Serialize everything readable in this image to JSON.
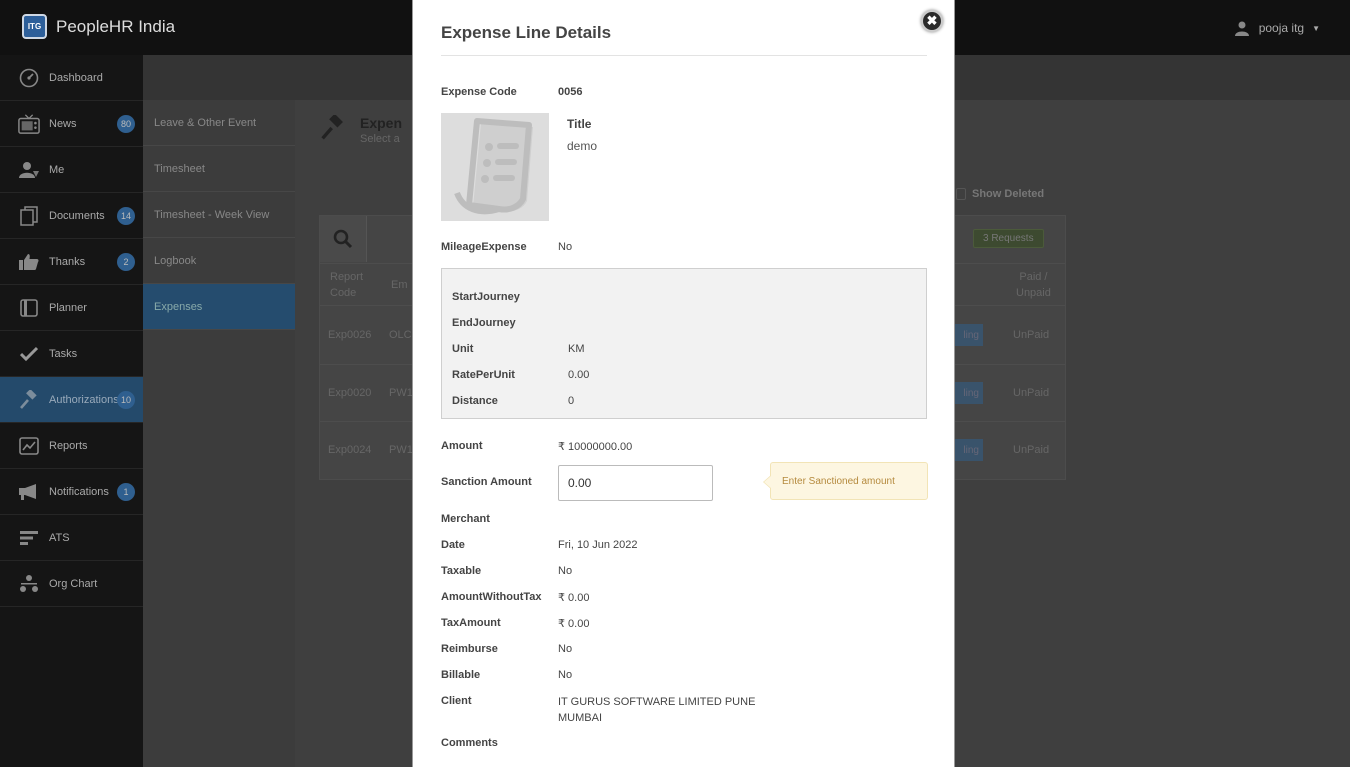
{
  "app": {
    "title": "PeopleHR India",
    "logo_text": "ITG",
    "user_name": "pooja itg"
  },
  "sidebar": {
    "items": [
      {
        "label": "Dashboard",
        "icon": "dashboard-icon",
        "badge": ""
      },
      {
        "label": "News",
        "icon": "tv-icon",
        "badge": "80"
      },
      {
        "label": "Me",
        "icon": "user-icon",
        "badge": ""
      },
      {
        "label": "Documents",
        "icon": "documents-icon",
        "badge": "14"
      },
      {
        "label": "Thanks",
        "icon": "thumbs-up-icon",
        "badge": "2"
      },
      {
        "label": "Planner",
        "icon": "planner-icon",
        "badge": ""
      },
      {
        "label": "Tasks",
        "icon": "check-icon",
        "badge": ""
      },
      {
        "label": "Authorizations",
        "icon": "gavel-icon",
        "badge": "10"
      },
      {
        "label": "Reports",
        "icon": "reports-icon",
        "badge": ""
      },
      {
        "label": "Notifications",
        "icon": "megaphone-icon",
        "badge": "1"
      },
      {
        "label": "ATS",
        "icon": "ats-icon",
        "badge": ""
      },
      {
        "label": "Org Chart",
        "icon": "org-chart-icon",
        "badge": ""
      }
    ],
    "active_index": 7
  },
  "subnav": {
    "items": [
      "Leave & Other Event",
      "Timesheet",
      "Timesheet - Week View",
      "Logbook",
      "Expenses"
    ],
    "active_index": 4
  },
  "background": {
    "panel_title": "Expen",
    "panel_subtitle": "Select a",
    "show_deleted": "Show Deleted",
    "requests_badge": "3 Requests",
    "headers": {
      "report_code": [
        "Report",
        "Code"
      ],
      "employee": "Em",
      "paid_unpaid": [
        "Paid /",
        "Unpaid"
      ]
    },
    "rows": [
      {
        "code": "Exp0026",
        "employee": "OLC",
        "status": "ling",
        "paid": "UnPaid"
      },
      {
        "code": "Exp0020",
        "employee": "PW1",
        "status": "ling",
        "paid": "UnPaid"
      },
      {
        "code": "Exp0024",
        "employee": "PW1",
        "status": "ling",
        "paid": "UnPaid"
      }
    ]
  },
  "modal": {
    "title": "Expense Line Details",
    "expense_code_label": "Expense Code",
    "expense_code": "0056",
    "title_label": "Title",
    "title_value": "demo",
    "mileage_label": "MileageExpense",
    "mileage_value": "No",
    "mileage": {
      "start_label": "StartJourney",
      "end_label": "EndJourney",
      "unit_label": "Unit",
      "unit_value": "KM",
      "rate_label": "RatePerUnit",
      "rate_value": "0.00",
      "distance_label": "Distance",
      "distance_value": "0"
    },
    "amount_label": "Amount",
    "amount_value": "₹ 10000000.00",
    "sanction_label": "Sanction Amount",
    "sanction_value": "0.00",
    "sanction_hint": "Enter Sanctioned amount",
    "merchant_label": "Merchant",
    "date_label": "Date",
    "date_value": "Fri, 10 Jun 2022",
    "taxable_label": "Taxable",
    "taxable_value": "No",
    "amount_without_tax_label": "AmountWithoutTax",
    "amount_without_tax_value": "₹ 0.00",
    "tax_amount_label": "TaxAmount",
    "tax_amount_value": "₹ 0.00",
    "reimburse_label": "Reimburse",
    "reimburse_value": "No",
    "billable_label": "Billable",
    "billable_value": "No",
    "client_label": "Client",
    "client_value": "IT GURUS SOFTWARE LIMITED PUNE MUMBAI",
    "comments_label": "Comments",
    "close_glyph": "✖"
  },
  "colors": {
    "accent": "#244a6b",
    "badge": "#2f5f8f",
    "hint_bg": "#fdf6e1"
  }
}
